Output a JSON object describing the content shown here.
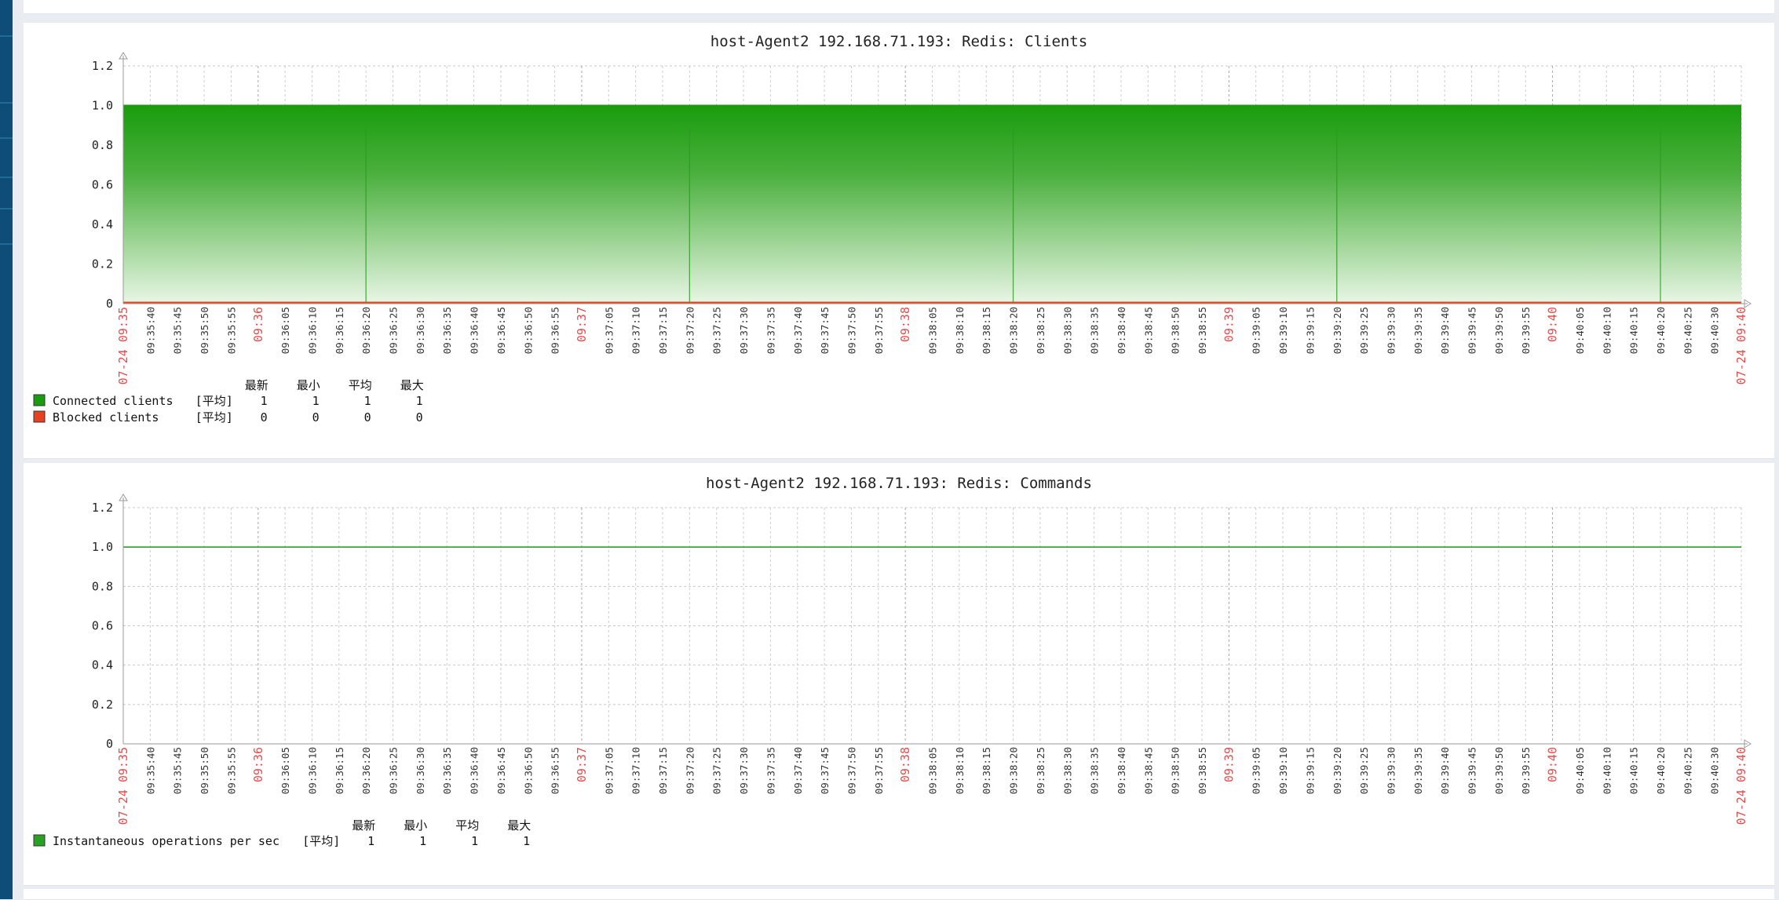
{
  "colors": {
    "connected": "#1a9c0e",
    "blocked": "#e8411f",
    "ops": "#2aa025",
    "major_tick": "#e84a4a"
  },
  "x_ticks": {
    "minor": [
      "09:35:40",
      "09:35:45",
      "09:35:50",
      "09:35:55",
      "09:36:05",
      "09:36:10",
      "09:36:15",
      "09:36:20",
      "09:36:25",
      "09:36:30",
      "09:36:35",
      "09:36:40",
      "09:36:45",
      "09:36:50",
      "09:36:55",
      "09:37:05",
      "09:37:10",
      "09:37:15",
      "09:37:20",
      "09:37:25",
      "09:37:30",
      "09:37:35",
      "09:37:40",
      "09:37:45",
      "09:37:50",
      "09:37:55",
      "09:38:05",
      "09:38:10",
      "09:38:15",
      "09:38:20",
      "09:38:25",
      "09:38:30",
      "09:38:35",
      "09:38:40",
      "09:38:45",
      "09:38:50",
      "09:38:55",
      "09:39:05",
      "09:39:10",
      "09:39:15",
      "09:39:20",
      "09:39:25",
      "09:39:30",
      "09:39:35",
      "09:39:40",
      "09:39:45",
      "09:39:50",
      "09:39:55",
      "09:40:05",
      "09:40:10",
      "09:40:15",
      "09:40:20",
      "09:40:25",
      "09:40:30"
    ],
    "major": [
      "09:36",
      "09:37",
      "09:38",
      "09:39",
      "09:40"
    ],
    "start": "07-24 09:35",
    "end": "07-24 09:40"
  },
  "legend_header": [
    "最新",
    "最小",
    "平均",
    "最大"
  ],
  "chart_data": [
    {
      "type": "area",
      "title": "host-Agent2 192.168.71.193: Redis: Clients",
      "ylim": [
        0,
        1.2
      ],
      "y_ticks": [
        "0",
        "0.2",
        "0.4",
        "0.6",
        "0.8",
        "1.0",
        "1.2"
      ],
      "grid": true,
      "series": [
        {
          "name": "Connected clients",
          "func": "[平均]",
          "last": "1",
          "min": "1",
          "avg": "1",
          "max": "1",
          "value": 1,
          "color": "#1a9c0e"
        },
        {
          "name": "Blocked clients",
          "func": "[平均]",
          "last": "0",
          "min": "0",
          "avg": "0",
          "max": "0",
          "value": 0,
          "color": "#e8411f"
        }
      ]
    },
    {
      "type": "line",
      "title": "host-Agent2 192.168.71.193: Redis: Commands",
      "ylim": [
        0,
        1.2
      ],
      "y_ticks": [
        "0",
        "0.2",
        "0.4",
        "0.6",
        "0.8",
        "1.0",
        "1.2"
      ],
      "grid": true,
      "series": [
        {
          "name": "Instantaneous operations per sec",
          "func": "[平均]",
          "last": "1",
          "min": "1",
          "avg": "1",
          "max": "1",
          "value": 1,
          "color": "#2aa025"
        }
      ]
    }
  ]
}
